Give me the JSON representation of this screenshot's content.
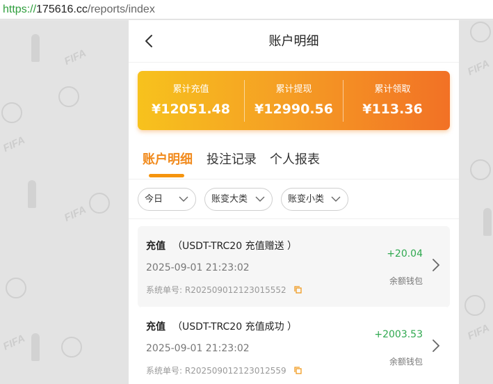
{
  "browser": {
    "url_scheme": "https://",
    "url_host": "175616.cc",
    "url_path": "/reports/index"
  },
  "header": {
    "title": "账户明细",
    "back_icon": "chevron-left-icon"
  },
  "summary": {
    "items": [
      {
        "label": "累计充值",
        "value": "¥12051.48"
      },
      {
        "label": "累计提现",
        "value": "¥12990.56"
      },
      {
        "label": "累计领取",
        "value": "¥113.36"
      }
    ]
  },
  "tabs": [
    {
      "label": "账户明细",
      "active": true
    },
    {
      "label": "投注记录",
      "active": false
    },
    {
      "label": "个人报表",
      "active": false
    }
  ],
  "filters": [
    {
      "label": "今日"
    },
    {
      "label": "账变大类"
    },
    {
      "label": "账变小类"
    }
  ],
  "background": {
    "watermark_text": "FIFA"
  },
  "records": [
    {
      "type": "充值",
      "detail": "（USDT-TRC20 充值赠送 ）",
      "datetime": "2025-09-01 21:23:02",
      "order_label": "系统单号: ",
      "order_no": "R202509012123015552",
      "amount": "+20.04",
      "wallet": "余额钱包"
    },
    {
      "type": "充值",
      "detail": "（USDT-TRC20 充值成功 ）",
      "datetime": "2025-09-01 21:23:02",
      "order_label": "系统单号: ",
      "order_no": "R202509012123012559",
      "amount": "+2003.53",
      "wallet": "余额钱包"
    }
  ],
  "colors": {
    "accent": "#f18a1c",
    "gradient_start": "#f7c21d",
    "gradient_end": "#f27125",
    "amount_positive": "#2fa84f"
  }
}
